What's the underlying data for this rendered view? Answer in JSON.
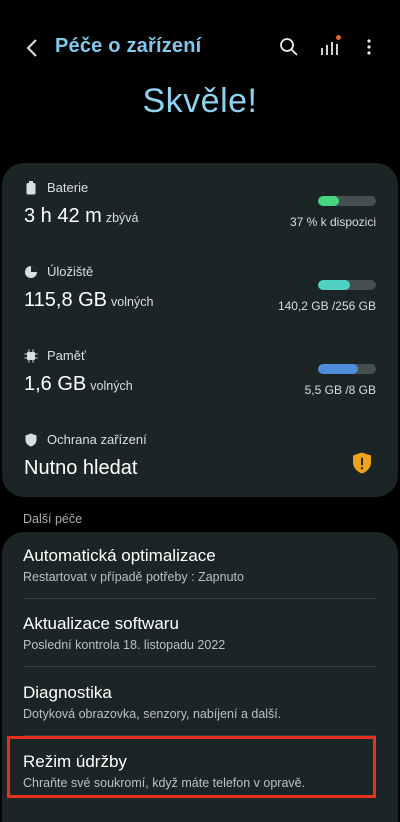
{
  "appbar": {
    "title": "Péče o zařízení",
    "back_icon": "back-arrow-icon",
    "actions": [
      {
        "icon": "search-icon"
      },
      {
        "icon": "bar-chart-icon",
        "has_notification_dot": true
      },
      {
        "icon": "more-vertical-icon"
      }
    ]
  },
  "hero": {
    "status": "Skvěle!"
  },
  "status": {
    "battery": {
      "label": "Baterie",
      "icon": "battery-icon",
      "value": "3 h 42 m",
      "unit": "zbývá",
      "meta": "37 % k dispozici",
      "progress": 0.37,
      "color": "#45d67e"
    },
    "storage": {
      "label": "Úložiště",
      "icon": "storage-pie-icon",
      "value": "115,8 GB",
      "unit": "volných",
      "meta": "140,2 GB /256 GB",
      "progress": 0.55,
      "color": "#4fd2c2"
    },
    "memory": {
      "label": "Paměť",
      "icon": "memory-chip-icon",
      "value": "1,6 GB",
      "unit": "volných",
      "meta": "5,5 GB /8 GB",
      "progress": 0.69,
      "color": "#4f8ddb"
    },
    "protection": {
      "label": "Ochrana zařízení",
      "icon": "shield-icon",
      "value": "Nutno hledat",
      "badge_icon": "warning-shield-icon",
      "badge_color": "#f0a21b"
    }
  },
  "more_care": {
    "section_title": "Další péče",
    "items": [
      {
        "title": "Automatická optimalizace",
        "subtitle": "Restartovat v případě potřeby : Zapnuto"
      },
      {
        "title": "Aktualizace softwaru",
        "subtitle": "Poslední kontrola 18. listopadu 2022"
      },
      {
        "title": "Diagnostika",
        "subtitle": "Dotyková obrazovka, senzory, nabíjení a další."
      },
      {
        "title": "Režim údržby",
        "subtitle": "Chraňte své soukromí, když máte telefon v opravě."
      }
    ]
  },
  "colors": {
    "accent": "#7fc8ea",
    "card_bg": "#1c2526",
    "highlight": "#e8301e"
  }
}
